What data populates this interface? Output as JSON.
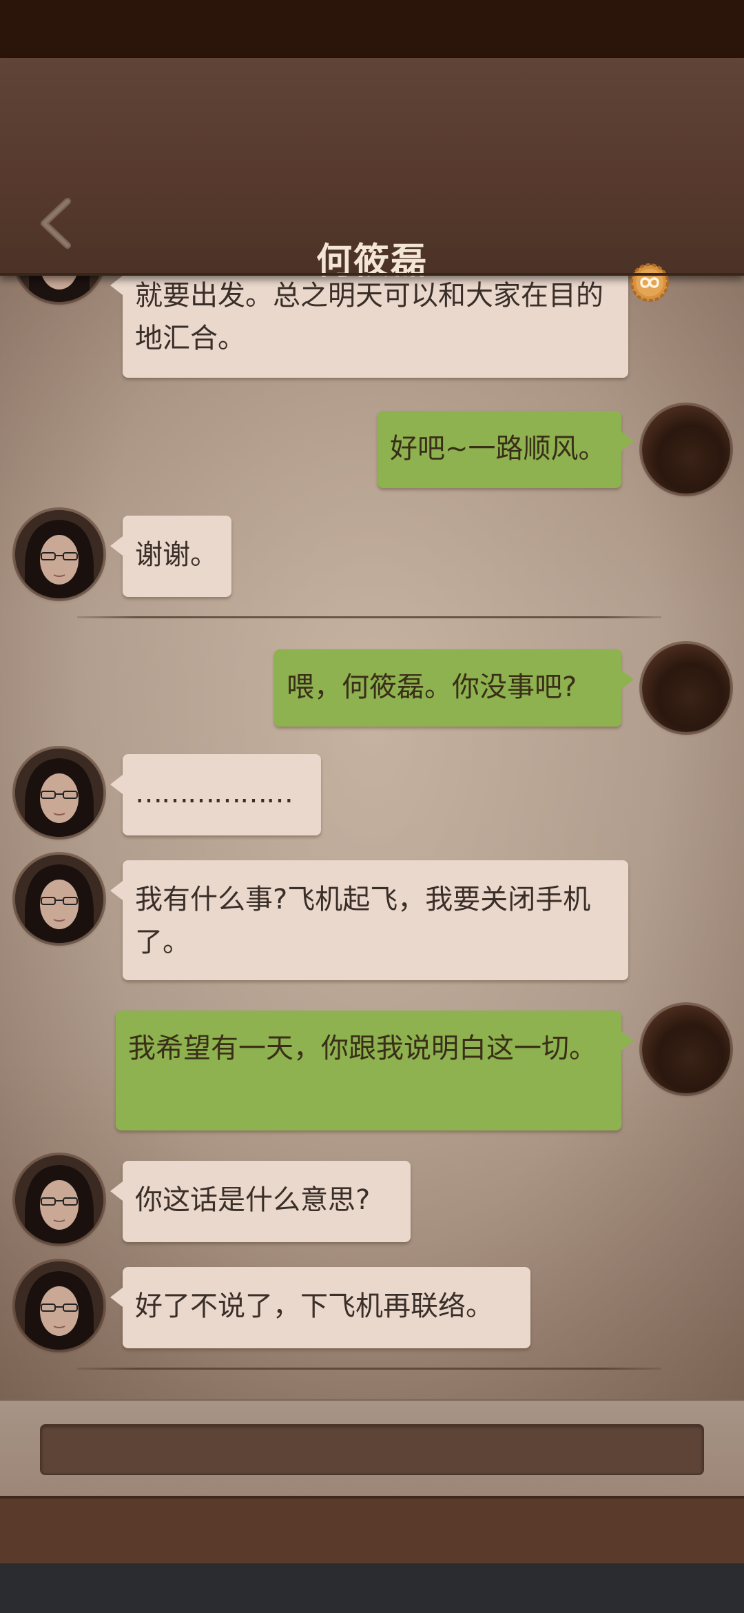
{
  "header": {
    "title": "何筱磊",
    "back_icon": "chevron-left-icon",
    "badge_icon": "infinity-badge-icon"
  },
  "colors": {
    "header": "#56392c",
    "incoming_bubble": "#ead8cc",
    "outgoing_bubble": "#8db24f",
    "chat_background": "#b3a091"
  },
  "messages": [
    {
      "from": "other",
      "text": "就要出发。总之明天可以和大家在目的地汇合。"
    },
    {
      "from": "self",
      "text": "好吧~一路顺风。"
    },
    {
      "from": "other",
      "text": "谢谢。"
    },
    {
      "from": "self",
      "text": "喂，何筱磊。你没事吧?"
    },
    {
      "from": "other",
      "text": "………………"
    },
    {
      "from": "other",
      "text": "我有什么事?飞机起飞，我要关闭手机了。"
    },
    {
      "from": "self",
      "text": "我希望有一天，你跟我说明白这一切。"
    },
    {
      "from": "other",
      "text": "你这话是什么意思?"
    },
    {
      "from": "other",
      "text": "好了不说了，下飞机再联络。"
    }
  ],
  "input": {
    "value": "",
    "placeholder": ""
  }
}
